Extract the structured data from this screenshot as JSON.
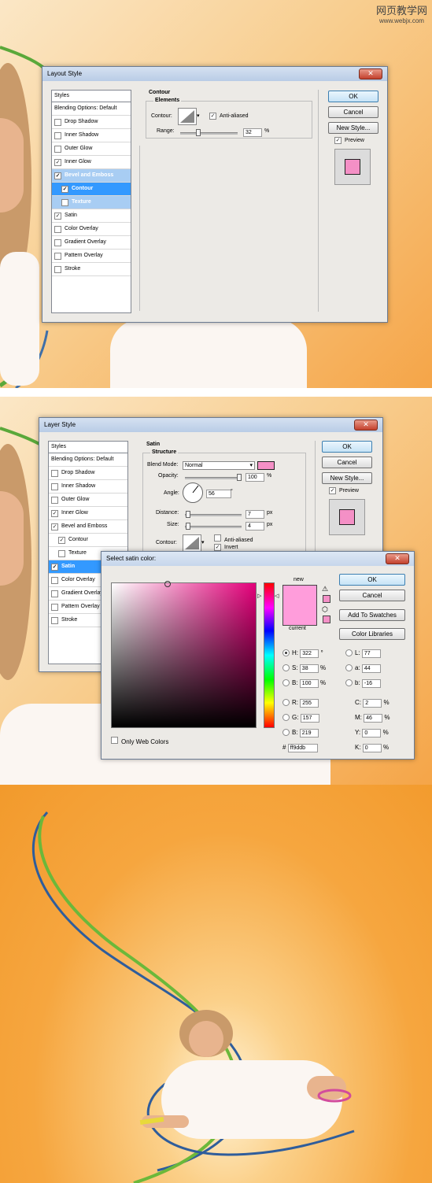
{
  "watermark": {
    "line1": "网页教学网",
    "line2": "www.webjx.com"
  },
  "colors": {
    "pink": "#f490c6",
    "new_color": "#ff9ddb",
    "bg_orange": "#f6a63f",
    "selected_row": "#3399ff"
  },
  "dialog1": {
    "title": "Layout Style",
    "close_icon": "close-icon",
    "section_title": "Contour",
    "group_title": "Elements",
    "contour_label": "Contour:",
    "anti_aliased_label": "Anti-aliased",
    "range_label": "Range:",
    "range_value": "32",
    "range_unit": "%",
    "buttons": {
      "ok": "OK",
      "cancel": "Cancel",
      "new_style": "New Style...",
      "preview": "Preview"
    },
    "styles_header": "Styles",
    "styles": [
      {
        "label": "Blending Options: Default",
        "checkbox": false,
        "checked": false
      },
      {
        "label": "Drop Shadow",
        "checkbox": true,
        "checked": false
      },
      {
        "label": "Inner Shadow",
        "checkbox": true,
        "checked": false
      },
      {
        "label": "Outer Glow",
        "checkbox": true,
        "checked": false
      },
      {
        "label": "Inner Glow",
        "checkbox": true,
        "checked": true
      },
      {
        "label": "Bevel and Emboss",
        "checkbox": true,
        "checked": true
      },
      {
        "label": "Contour",
        "checkbox": true,
        "checked": true
      },
      {
        "label": "Texture",
        "checkbox": true,
        "checked": false
      },
      {
        "label": "Satin",
        "checkbox": true,
        "checked": true
      },
      {
        "label": "Color Overlay",
        "checkbox": true,
        "checked": false
      },
      {
        "label": "Gradient Overlay",
        "checkbox": true,
        "checked": false
      },
      {
        "label": "Pattern Overlay",
        "checkbox": true,
        "checked": false
      },
      {
        "label": "Stroke",
        "checkbox": true,
        "checked": false
      }
    ]
  },
  "dialog2": {
    "title": "Layer Style",
    "section_title": "Satin",
    "group_title": "Structure",
    "blend_mode_label": "Blend Mode:",
    "blend_mode_value": "Normal",
    "opacity_label": "Opacity:",
    "opacity_value": "100",
    "angle_label": "Angle:",
    "angle_value": "56",
    "angle_unit": "°",
    "distance_label": "Distance:",
    "distance_value": "7",
    "size_label": "Size:",
    "size_value": "4",
    "px": "px",
    "percent": "%",
    "contour_label": "Contour:",
    "anti_aliased_label": "Anti-aliased",
    "invert_label": "Invert",
    "buttons": {
      "ok": "OK",
      "cancel": "Cancel",
      "new_style": "New Style...",
      "preview": "Preview"
    },
    "styles_header": "Styles",
    "styles": [
      {
        "label": "Blending Options: Default",
        "checkbox": false,
        "checked": false
      },
      {
        "label": "Drop Shadow",
        "checkbox": true,
        "checked": false
      },
      {
        "label": "Inner Shadow",
        "checkbox": true,
        "checked": false
      },
      {
        "label": "Outer Glow",
        "checkbox": true,
        "checked": false
      },
      {
        "label": "Inner Glow",
        "checkbox": true,
        "checked": true
      },
      {
        "label": "Bevel and Emboss",
        "checkbox": true,
        "checked": true
      },
      {
        "label": "Contour",
        "checkbox": true,
        "checked": true
      },
      {
        "label": "Texture",
        "checkbox": true,
        "checked": false
      },
      {
        "label": "Satin",
        "checkbox": true,
        "checked": true
      },
      {
        "label": "Color Overlay",
        "checkbox": true,
        "checked": false
      },
      {
        "label": "Gradient Overlay",
        "checkbox": true,
        "checked": false
      },
      {
        "label": "Pattern Overlay",
        "checkbox": true,
        "checked": false
      },
      {
        "label": "Stroke",
        "checkbox": true,
        "checked": false
      }
    ]
  },
  "picker": {
    "title": "Select satin color:",
    "new_label": "new",
    "current_label": "current",
    "buttons": {
      "ok": "OK",
      "cancel": "Cancel",
      "add_swatches": "Add To Swatches",
      "color_libraries": "Color Libraries"
    },
    "only_web_colors": "Only Web Colors",
    "hsb": [
      {
        "label": "H:",
        "value": "322",
        "unit": "°",
        "on": true
      },
      {
        "label": "S:",
        "value": "38",
        "unit": "%",
        "on": false
      },
      {
        "label": "B:",
        "value": "100",
        "unit": "%",
        "on": false
      }
    ],
    "rgb": [
      {
        "label": "R:",
        "value": "255"
      },
      {
        "label": "G:",
        "value": "157"
      },
      {
        "label": "B:",
        "value": "219"
      }
    ],
    "lab": [
      {
        "label": "L:",
        "value": "77"
      },
      {
        "label": "a:",
        "value": "44"
      },
      {
        "label": "b:",
        "value": "-16"
      }
    ],
    "cmyk": [
      {
        "label": "C:",
        "value": "2",
        "unit": "%"
      },
      {
        "label": "M:",
        "value": "46",
        "unit": "%"
      },
      {
        "label": "Y:",
        "value": "0",
        "unit": "%"
      },
      {
        "label": "K:",
        "value": "0",
        "unit": "%"
      }
    ],
    "hex_label": "#",
    "hex_value": "ff9ddb"
  }
}
